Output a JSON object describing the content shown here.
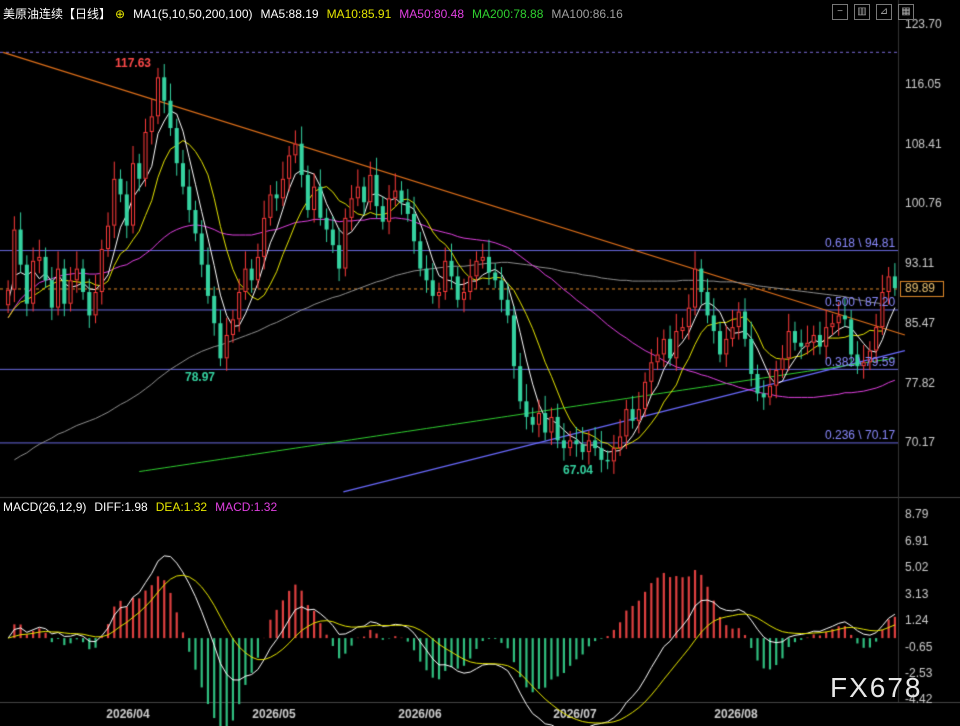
{
  "header": {
    "instrument": "美原油连续",
    "period": "【日线】",
    "settings_glyph": "⊕",
    "ma_label": "MA1(5,10,50,200,100)",
    "ma5": "MA5:88.19",
    "ma10": "MA10:85.91",
    "ma50": "MA50:80.48",
    "ma200": "MA200:78.88",
    "ma100": "MA100:86.16",
    "colors": {
      "ma5": "#ffffff",
      "ma10": "#e6e600",
      "ma50": "#e040e0",
      "ma200": "#30d030",
      "ma100": "#909090"
    }
  },
  "macd_header": {
    "label": "MACD(26,12,9)",
    "diff": "DIFF:1.98",
    "dea": "DEA:1.32",
    "macd": "MACD:1.32",
    "colors": {
      "diff": "#ffffff",
      "dea": "#e6e600",
      "macd": "#e040e0"
    }
  },
  "logo": "FX678",
  "chart_data": [
    {
      "type": "candlestick",
      "y_ticks": [
        "123.70",
        "116.05",
        "108.41",
        "100.76",
        "93.11",
        "85.47",
        "77.82",
        "70.17"
      ],
      "ylim": [
        63.5,
        123.7
      ],
      "x_ticks": [
        "2026/04",
        "2026/05",
        "2026/06",
        "2026/07",
        "2026/08"
      ],
      "current_price": "89.89",
      "annotations": {
        "high": "117.63",
        "low_1": "78.97",
        "low_2": "67.04"
      },
      "fibonacci": [
        {
          "level": "0.618",
          "price": 94.81,
          "label": "0.618 \\ 94.81"
        },
        {
          "level": "0.500",
          "price": 87.2,
          "label": "0.500 \\ 87.20"
        },
        {
          "level": "0.382",
          "price": 79.59,
          "label": "0.382 \\ 79.59"
        },
        {
          "level": "0.236",
          "price": 70.17,
          "label": "0.236 \\ 70.17"
        }
      ],
      "reference_line": 120.2,
      "close": [
        89.8,
        97.5,
        93.0,
        88.0,
        93.5,
        94.0,
        91.0,
        87.5,
        92.5,
        88.0,
        91.0,
        92.5,
        89.5,
        86.5,
        89.5,
        95.0,
        98.0,
        104.0,
        102.0,
        98.0,
        106.0,
        104.0,
        110.0,
        112.0,
        117.0,
        114.0,
        110.5,
        106.0,
        103.0,
        100.0,
        97.0,
        93.0,
        89.0,
        85.5,
        81.0,
        84.0,
        86.0,
        89.5,
        92.5,
        91.0,
        94.0,
        99.0,
        102.0,
        101.5,
        104.0,
        107.0,
        108.5,
        104.5,
        100.0,
        103.0,
        99.0,
        97.5,
        95.5,
        92.5,
        99.0,
        101.5,
        103.0,
        101.0,
        104.5,
        100.5,
        98.5,
        101.5,
        102.5,
        101.0,
        99.5,
        96.0,
        92.5,
        91.0,
        89.0,
        89.5,
        93.5,
        91.5,
        88.5,
        89.5,
        91.5,
        93.5,
        94.0,
        92.0,
        91.0,
        88.5,
        86.5,
        80.0,
        75.5,
        73.5,
        72.5,
        74.0,
        71.5,
        73.5,
        70.5,
        69.5,
        70.5,
        70.0,
        69.0,
        70.5,
        69.5,
        68.0,
        67.8,
        69.5,
        71.0,
        74.5,
        73.0,
        74.5,
        78.0,
        80.5,
        81.5,
        83.5,
        81.0,
        84.5,
        85.0,
        87.5,
        92.5,
        89.5,
        86.5,
        84.5,
        81.5,
        83.5,
        85.0,
        87.0,
        83.5,
        79.0,
        76.5,
        76.0,
        77.5,
        79.5,
        81.0,
        84.5,
        83.0,
        82.5,
        83.0,
        84.0,
        82.5,
        85.0,
        85.5,
        86.5,
        86.0,
        81.5,
        80.0,
        80.5,
        82.0,
        85.0,
        89.5,
        91.5,
        90.0
      ],
      "ma5": [
        88.1,
        91.6,
        92.0,
        91.6,
        92.3,
        91.2,
        91.9,
        90.8,
        91.7,
        90.6,
        90.1,
        90.3,
        90.7,
        89.9,
        89.8,
        90.6,
        91.7,
        94.7,
        97.8,
        99.4,
        101.6,
        102.8,
        104.0,
        105.6,
        109.8,
        111.4,
        112.7,
        112.3,
        110.1,
        106.7,
        103.3,
        99.8,
        96.4,
        92.9,
        89.1,
        86.5,
        85.1,
        85.2,
        86.7,
        88.6,
        90.6,
        93.2,
        95.8,
        97.6,
        100.1,
        102.7,
        104.6,
        105.1,
        104.9,
        104.6,
        103.0,
        100.8,
        99.2,
        97.5,
        96.7,
        97.2,
        98.3,
        99.4,
        101.9,
        102.1,
        101.7,
        101.2,
        101.5,
        100.8,
        100.6,
        100.1,
        98.3,
        96.1,
        93.6,
        91.6,
        91.1,
        90.9,
        90.4,
        90.5,
        90.9,
        90.9,
        91.7,
        92.1,
        92.4,
        91.8,
        90.4,
        87.6,
        84.3,
        80.8,
        77.7,
        75.1,
        73.4,
        73.1,
        72.6,
        71.8,
        71.1,
        70.7,
        69.9,
        69.9,
        69.9,
        69.4,
        69.0,
        69.1,
        69.2,
        70.1,
        71.1,
        72.5,
        74.2,
        76.3,
        77.5,
        79.6,
        80.9,
        82.2,
        83.1,
        84.3,
        86.1,
        87.8,
        88.2,
        87.7,
        86.9,
        85.1,
        84.2,
        84.3,
        84.5,
        83.6,
        82.2,
        80.4,
        78.6,
        77.7,
        78.1,
        79.7,
        80.9,
        82.1,
        82.8,
        83.4,
        83.0,
        83.4,
        84.0,
        84.7,
        85.1,
        84.9,
        83.9,
        82.9,
        82.0,
        81.8,
        83.4,
        85.7,
        87.5
      ],
      "ma10": [
        86.2,
        87.4,
        88.2,
        88.5,
        89.0,
        89.5,
        90.1,
        90.5,
        90.9,
        91.0,
        90.9,
        90.8,
        90.7,
        90.8,
        90.4,
        90.3,
        90.9,
        92.9,
        94.4,
        95.0,
        96.2,
        97.3,
        99.3,
        101.2,
        104.2,
        106.3,
        107.8,
        108.3,
        108.9,
        108.4,
        107.5,
        106.2,
        104.5,
        101.5,
        97.9,
        94.9,
        92.4,
        90.6,
        89.8,
        88.9,
        88.5,
        89.1,
        90.5,
        92.1,
        94.3,
        96.2,
        98.2,
        99.9,
        101.2,
        102.3,
        102.8,
        103.0,
        102.3,
        101.2,
        100.8,
        100.1,
        99.5,
        99.3,
        99.7,
        99.4,
        99.4,
        99.7,
        100.4,
        101.3,
        101.4,
        100.9,
        99.7,
        98.7,
        97.2,
        96.2,
        95.6,
        94.6,
        93.2,
        92.1,
        91.3,
        91.0,
        91.3,
        91.2,
        91.4,
        91.3,
        90.6,
        89.7,
        88.2,
        86.6,
        84.8,
        82.7,
        80.5,
        78.7,
        76.7,
        74.7,
        73.1,
        72.0,
        71.5,
        71.3,
        70.9,
        70.3,
        70.1,
        69.5,
        69.5,
        69.9,
        70.3,
        70.8,
        71.7,
        72.7,
        73.8,
        75.4,
        76.5,
        77.6,
        79.6,
        81.0,
        82.8,
        84.3,
        85.2,
        85.4,
        85.6,
        85.6,
        86.0,
        86.1,
        86.4,
        85.5,
        84.1,
        82.3,
        81.5,
        81.0,
        80.9,
        80.9,
        81.2,
        81.3,
        81.7,
        82.3,
        82.8,
        83.6,
        83.6,
        83.6,
        83.7,
        84.0,
        83.9,
        84.1,
        84.6,
        84.5,
        84.5
      ],
      "ma50": [
        86.2,
        87.5,
        88.6,
        89.4,
        90.0,
        90.7,
        91.0,
        91.2,
        91.5,
        91.7,
        91.8,
        91.9,
        91.9,
        91.8,
        91.8,
        91.9,
        92.1,
        92.5,
        92.8,
        93.0,
        93.5,
        93.8,
        94.4,
        95.0,
        95.8,
        96.5,
        97.1,
        97.5,
        97.8,
        98.0,
        98.1,
        98.0,
        97.8,
        97.5,
        97.1,
        96.9,
        96.8,
        96.8,
        96.8,
        96.8,
        97.0,
        97.2,
        97.4,
        97.5,
        97.8,
        98.1,
        98.4,
        98.5,
        98.6,
        98.8,
        98.8,
        98.8,
        98.7,
        98.5,
        98.6,
        98.6,
        98.7,
        98.7,
        98.9,
        98.9,
        98.9,
        98.9,
        99.0,
        98.9,
        98.8,
        98.5,
        98.2,
        97.9,
        97.5,
        97.3,
        97.1,
        96.9,
        96.6,
        96.4,
        96.3,
        96.2,
        96.1,
        96.0,
        95.8,
        95.5,
        95.2,
        94.7,
        94.1,
        93.5,
        92.9,
        92.4,
        91.7,
        91.2,
        90.5,
        89.8,
        89.2,
        88.5,
        87.9,
        87.3,
        86.7,
        86.0,
        85.3,
        84.7,
        84.1,
        83.6,
        83.0,
        82.5,
        82.0,
        81.6,
        81.2,
        80.7,
        80.3,
        79.9,
        79.7,
        79.4,
        79.2,
        78.9,
        78.7,
        78.4,
        78.1,
        77.8,
        77.6,
        77.3,
        77.1,
        76.9,
        76.7,
        76.5,
        76.4,
        76.2,
        76.1,
        76.0,
        76.0,
        76.0,
        76.0,
        76.0,
        76.1,
        76.2,
        76.3,
        76.4,
        76.6,
        76.6,
        76.7,
        76.8,
        77.0,
        77.2,
        77.5,
        77.9,
        78.2
      ],
      "ma100": [
        null,
        68.0,
        68.5,
        68.9,
        69.5,
        70.0,
        70.4,
        70.8,
        71.3,
        71.6,
        72.0,
        72.4,
        72.7,
        73.0,
        73.3,
        73.7,
        74.1,
        74.6,
        75.1,
        75.5,
        76.0,
        76.5,
        77.1,
        77.7,
        78.4,
        79.0,
        79.6,
        80.1,
        80.6,
        81.1,
        81.5,
        81.9,
        82.2,
        82.5,
        82.7,
        83.0,
        83.3,
        83.6,
        83.9,
        84.2,
        84.5,
        84.9,
        85.3,
        85.6,
        86.0,
        86.4,
        86.8,
        87.2,
        87.5,
        87.9,
        88.2,
        88.5,
        88.8,
        89.0,
        89.3,
        89.6,
        89.9,
        90.2,
        90.5,
        90.8,
        91.0,
        91.3,
        91.6,
        91.8,
        92.0,
        92.2,
        92.3,
        92.4,
        92.5,
        92.6,
        92.7,
        92.8,
        92.8,
        92.8,
        92.9,
        93.0,
        93.1,
        93.2,
        93.2,
        93.3,
        93.3,
        93.2,
        93.1,
        93.0,
        92.9,
        92.7,
        92.6,
        92.5,
        92.3,
        92.1,
        92.0,
        91.9,
        91.7,
        91.6,
        91.5,
        91.3,
        91.2,
        91.1,
        91.0,
        91.0,
        90.9,
        90.9,
        90.9,
        90.9,
        90.9,
        90.9,
        90.9,
        90.9,
        91.0,
        91.0,
        91.0,
        91.0,
        90.9,
        90.9,
        90.8,
        90.8,
        90.8,
        90.7,
        90.6,
        90.5,
        90.3,
        90.2,
        90.1,
        90.0,
        89.9,
        89.8,
        89.7,
        89.6,
        89.5,
        89.4,
        89.3,
        89.2,
        89.1,
        89.0,
        88.9,
        88.7,
        88.5,
        88.4,
        88.2,
        88.1,
        88.0
      ],
      "ma200": [
        null,
        null,
        null,
        null,
        null,
        null,
        null,
        null,
        null,
        null,
        null,
        null,
        null,
        null,
        null,
        null,
        null,
        null,
        null,
        null,
        null,
        null,
        null,
        null,
        null,
        null,
        null,
        null,
        null,
        null,
        null,
        null,
        null,
        null,
        null,
        null,
        null,
        null,
        null,
        null,
        null,
        null,
        null,
        null,
        null,
        null,
        null,
        null,
        null,
        null,
        null,
        null,
        null,
        null,
        null,
        null,
        null,
        null,
        null,
        null,
        null,
        null,
        null,
        null,
        null,
        null,
        null,
        null,
        null,
        null,
        null,
        null,
        null,
        null,
        null,
        null,
        null,
        null,
        null,
        null,
        null,
        null,
        null,
        null,
        null,
        null,
        null,
        null,
        null,
        null,
        null,
        null,
        null,
        null,
        null,
        null,
        null,
        null,
        null,
        null,
        null,
        null,
        null,
        null,
        null,
        null,
        null,
        null,
        null,
        null,
        null,
        null,
        null,
        null,
        null,
        null,
        null,
        null,
        null,
        null,
        null,
        null,
        null,
        null,
        null,
        null,
        null,
        null,
        null,
        null,
        null,
        null,
        null,
        null,
        null,
        null,
        null,
        null,
        null,
        null,
        null,
        null,
        null,
        null,
        null,
        null
      ]
    },
    {
      "type": "bar",
      "y_ticks": [
        "8.79",
        "6.91",
        "5.02",
        "3.13",
        "1.24",
        "-0.65",
        "-2.53",
        "-4.42"
      ],
      "ylim": [
        -4.42,
        8.79
      ],
      "diff_last": "1.98",
      "dea_last": "1.32",
      "macd_last": "1.32"
    }
  ]
}
